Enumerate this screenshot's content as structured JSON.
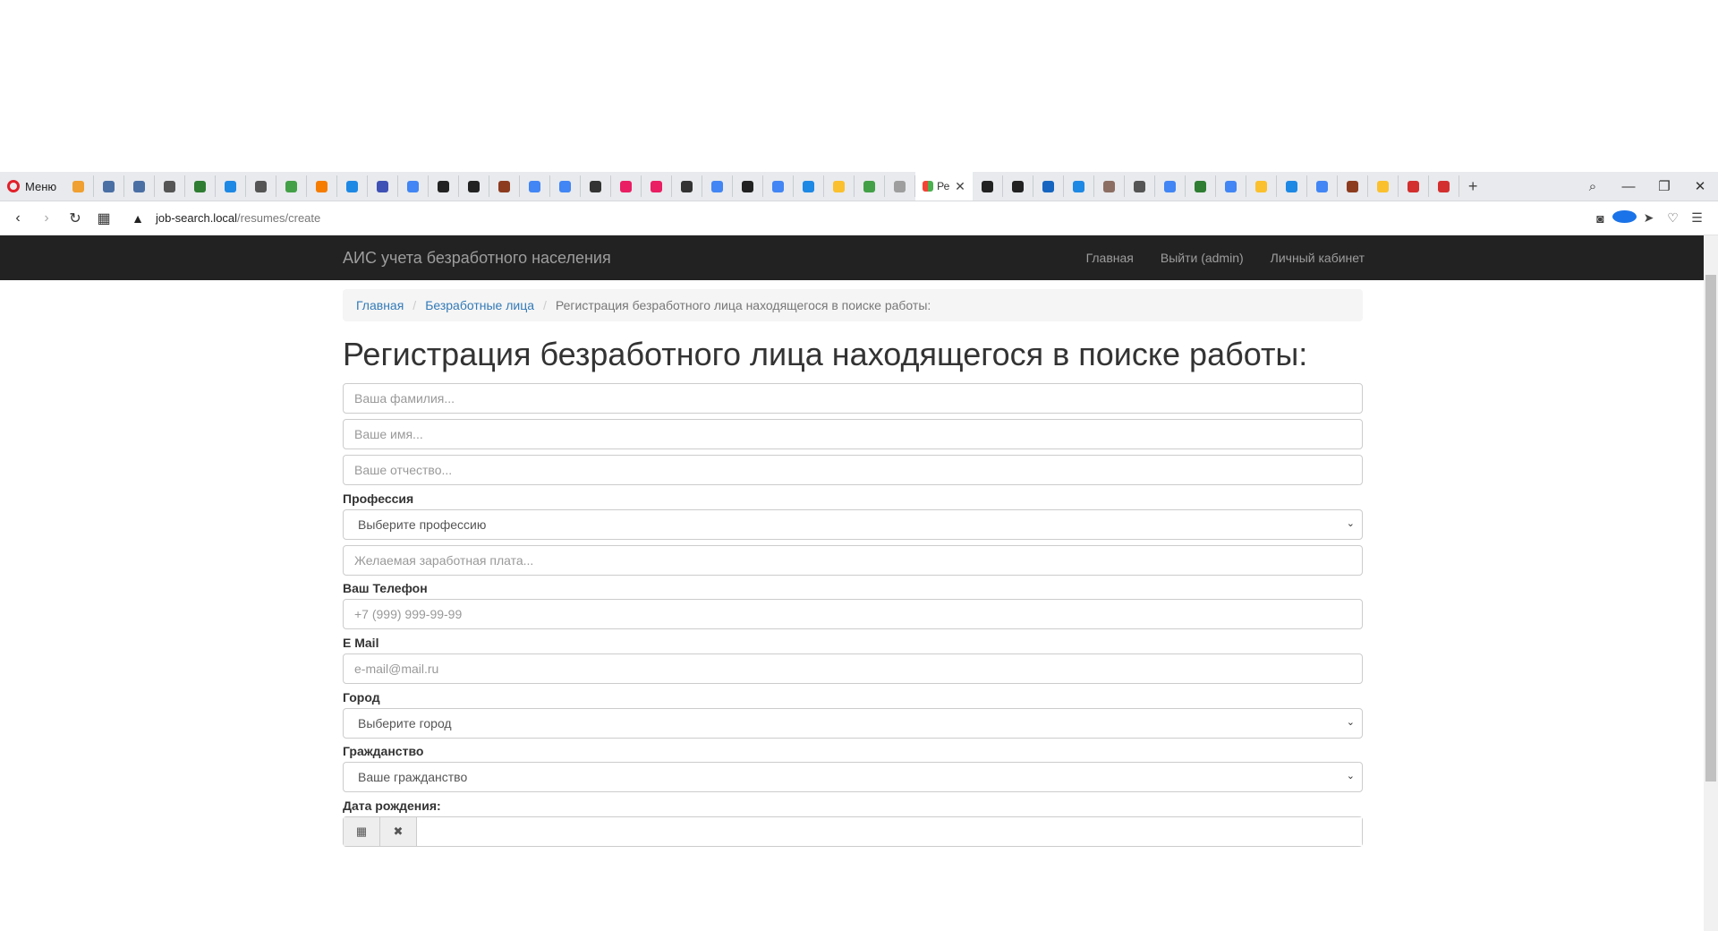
{
  "browser": {
    "menu_label": "Меню",
    "active_tab_title": "Ре",
    "url_host": "job-search.local",
    "url_path": "/resumes/create",
    "tab_favicon_colors": [
      "#f0a030",
      "#4a6fa5",
      "#4a6fa5",
      "#555",
      "#2e7d32",
      "#1e88e5",
      "#555",
      "#43a047",
      "#f57c00",
      "#1e88e5",
      "#3f51b5",
      "#4285f4",
      "#222",
      "#222",
      "#8d3b1f",
      "#4285f4",
      "#4285f4",
      "#333",
      "#e91e63",
      "#e91e63",
      "#333",
      "#4285f4",
      "#222",
      "#4285f4",
      "#1e88e5",
      "#fbc02d",
      "#43a047",
      "#9e9e9e"
    ],
    "tab_favicon_colors_after": [
      "#222",
      "#222",
      "#1565c0",
      "#1e88e5",
      "#8d6e63",
      "#555",
      "#4285f4",
      "#2e7d32",
      "#4285f4",
      "#fbc02d",
      "#1e88e5",
      "#4285f4",
      "#8d3b1f",
      "#fbc02d",
      "#d32f2f",
      "#d32f2f"
    ]
  },
  "navbar": {
    "brand": "АИС учета безработного населения",
    "links": [
      "Главная",
      "Выйти (admin)",
      "Личный кабинет"
    ]
  },
  "breadcrumb": {
    "home": "Главная",
    "section": "Безработные лица",
    "current": "Регистрация безработного лица находящегося в поиске работы:"
  },
  "page_title": "Регистрация безработного лица находящегося в поиске работы:",
  "form": {
    "lastname_placeholder": "Ваша фамилия...",
    "firstname_placeholder": "Ваше имя...",
    "patronymic_placeholder": "Ваше отчество...",
    "profession_label": "Профессия",
    "profession_selected": "Выберите профессию",
    "salary_placeholder": "Желаемая заработная плата...",
    "phone_label": "Ваш Телефон",
    "phone_placeholder": "+7 (999) 999-99-99",
    "email_label": "E Mail",
    "email_placeholder": "e-mail@mail.ru",
    "city_label": "Город",
    "city_selected": "Выберите город",
    "citizenship_label": "Гражданство",
    "citizenship_selected": "Ваше гражданство",
    "birthdate_label": "Дата рождения:"
  }
}
